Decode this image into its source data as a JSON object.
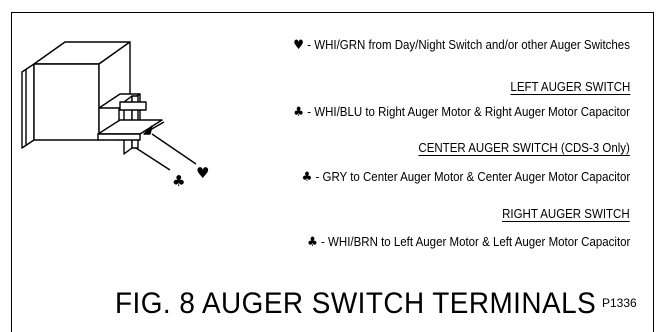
{
  "legend": {
    "line1_symbol": "♥",
    "line1_text": " - WHI/GRN from Day/Night Switch and/or other Auger Switches",
    "heading_left": "LEFT AUGER SWITCH",
    "line2_symbol": "♣",
    "line2_text": " - WHI/BLU to Right Auger Motor & Right Auger Motor Capacitor",
    "heading_center": "CENTER AUGER SWITCH (CDS-3 Only)",
    "line3_symbol": "♣",
    "line3_text": " - GRY to Center Auger Motor & Center Auger Motor Capacitor",
    "heading_right": "RIGHT AUGER SWITCH",
    "line4_symbol": "♣",
    "line4_text": " - WHI/BRN to Left Auger Motor & Left Auger Motor Capacitor"
  },
  "diagram": {
    "club_symbol": "♣",
    "heart_symbol": "♥"
  },
  "caption": {
    "title": "FIG. 8 AUGER SWITCH TERMINALS",
    "code": "P1336"
  }
}
